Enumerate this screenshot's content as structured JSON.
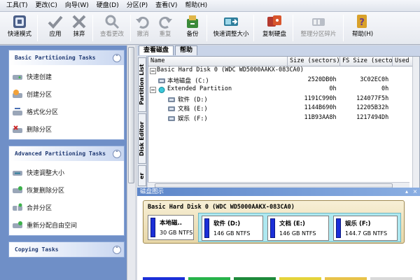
{
  "menu": [
    "工具(T)",
    "更改(C)",
    "向导(W)",
    "硬盘(D)",
    "分区(P)",
    "查看(V)",
    "帮助(H)"
  ],
  "toolbar": {
    "express": "快速模式",
    "apply": "应用",
    "discard": "抹弃",
    "view_changes": "查看更改",
    "undo": "撤消",
    "redo": "重复",
    "backup": "备份",
    "quick_resize": "快速调整大小",
    "copy_disk": "复制硬盘",
    "defrag": "整理分区碎片",
    "help": "帮助(H)"
  },
  "left": {
    "basic": {
      "title": "Basic Partitioning Tasks",
      "items": [
        "快速创建",
        "创建分区",
        "格式化分区",
        "删除分区"
      ]
    },
    "advanced": {
      "title": "Advanced Partitioning Tasks",
      "items": [
        "快速调整大小",
        "恢复删除分区",
        "合并分区",
        "重新分配自由空间"
      ]
    },
    "copy": {
      "title": "Copying Tasks"
    }
  },
  "tabs": [
    "查看磁盘",
    "帮助"
  ],
  "side_tabs": [
    "Partition List",
    "Disk Editor",
    "er"
  ],
  "grid": {
    "columns": [
      "Name",
      "Size (sectors)",
      "FS Size (sectors)",
      "Used"
    ],
    "rows": [
      {
        "name": "Basic Hard Disk 0 (WDC WD5000AAKX-083CA0)",
        "size": "",
        "fs": ""
      },
      {
        "name": "本地磁盘 (C:)",
        "size": "2520DB0h",
        "fs": "3C02EC0h"
      },
      {
        "name": "Extended Partition",
        "size": "0h",
        "fs": "0h"
      },
      {
        "name": "软件 (D:)",
        "size": "1191C990h",
        "fs": "124077F5h"
      },
      {
        "name": "文档 (E:)",
        "size": "1144B690h",
        "fs": "12205B32h"
      },
      {
        "name": "娱乐 (F:)",
        "size": "11B93AA8h",
        "fs": "1217494Dh"
      }
    ]
  },
  "map": {
    "title": "磁盘图示",
    "disk_label": "Basic Hard Disk 0 (WDC WD5000AAKX-083CA0)",
    "parts": [
      {
        "name": "本地磁..",
        "size": "30 GB NTFS"
      },
      {
        "name": "软件 (D:)",
        "size": "146 GB NTFS"
      },
      {
        "name": "文档 (E:)",
        "size": "146 GB NTFS"
      },
      {
        "name": "娱乐 (F:)",
        "size": "144.7 GB NTFS"
      }
    ]
  },
  "colors": {
    "partition_bar": "#1b2fd8",
    "extended": "#aee8f0",
    "left_bg": "#6f8fc7",
    "disk_bg": "#e8d7a8"
  }
}
